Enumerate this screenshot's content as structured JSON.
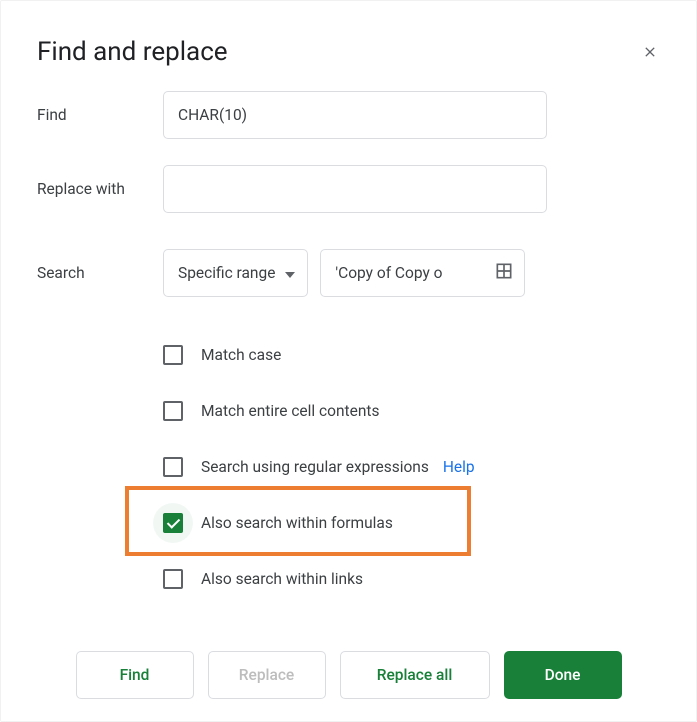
{
  "dialog": {
    "title": "Find and replace",
    "find_label": "Find",
    "find_value": "CHAR(10)",
    "replace_label": "Replace with",
    "replace_value": "",
    "search_label": "Search",
    "scope_selected": "Specific range",
    "range_value": "'Copy of Copy o",
    "options": [
      {
        "label": "Match case",
        "checked": false,
        "highlighted": false
      },
      {
        "label": "Match entire cell contents",
        "checked": false,
        "highlighted": false
      },
      {
        "label": "Search using regular expressions",
        "checked": false,
        "highlighted": false,
        "help": "Help"
      },
      {
        "label": "Also search within formulas",
        "checked": true,
        "highlighted": true
      },
      {
        "label": "Also search within links",
        "checked": false,
        "highlighted": false
      }
    ],
    "buttons": {
      "find": "Find",
      "replace": "Replace",
      "replace_all": "Replace all",
      "done": "Done"
    }
  }
}
